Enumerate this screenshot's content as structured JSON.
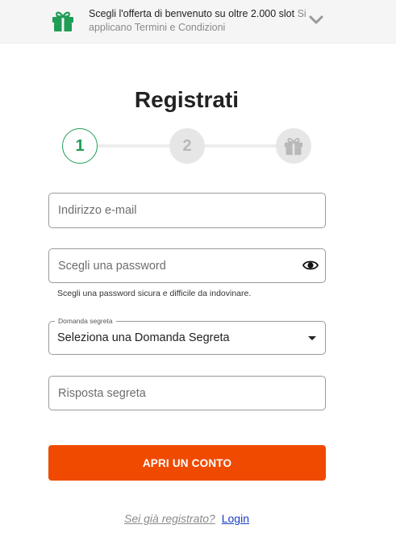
{
  "banner": {
    "line_main": "Scegli l'offerta di benvenuto su oltre 2.000 slot",
    "line_muted": "Si applicano Termini e Condizioni",
    "gift_icon": "gift-icon",
    "expand_icon": "chevron-down-icon",
    "accent_color": "#1f9d55"
  },
  "form": {
    "title": "Registrati",
    "steps": [
      {
        "label": "1",
        "state": "active"
      },
      {
        "label": "2",
        "state": "pending"
      },
      {
        "label": "",
        "icon": "gift-icon",
        "state": "pending"
      }
    ],
    "email": {
      "placeholder": "Indirizzo e-mail",
      "value": ""
    },
    "password": {
      "placeholder": "Scegli una password",
      "value": "",
      "hint": "Scegli una password sicura e difficile da indovinare.",
      "toggle_icon": "eye-icon"
    },
    "secret_question": {
      "label": "Domanda segreta",
      "selected": "Seleziona una Domanda Segreta"
    },
    "secret_answer": {
      "placeholder": "Risposta segreta",
      "value": ""
    },
    "submit_label": "APRI UN CONTO",
    "submit_color": "#f04a00",
    "already_registered": "Sei già registrato?",
    "login_label": "Login",
    "link_color": "#1a3cc7"
  }
}
